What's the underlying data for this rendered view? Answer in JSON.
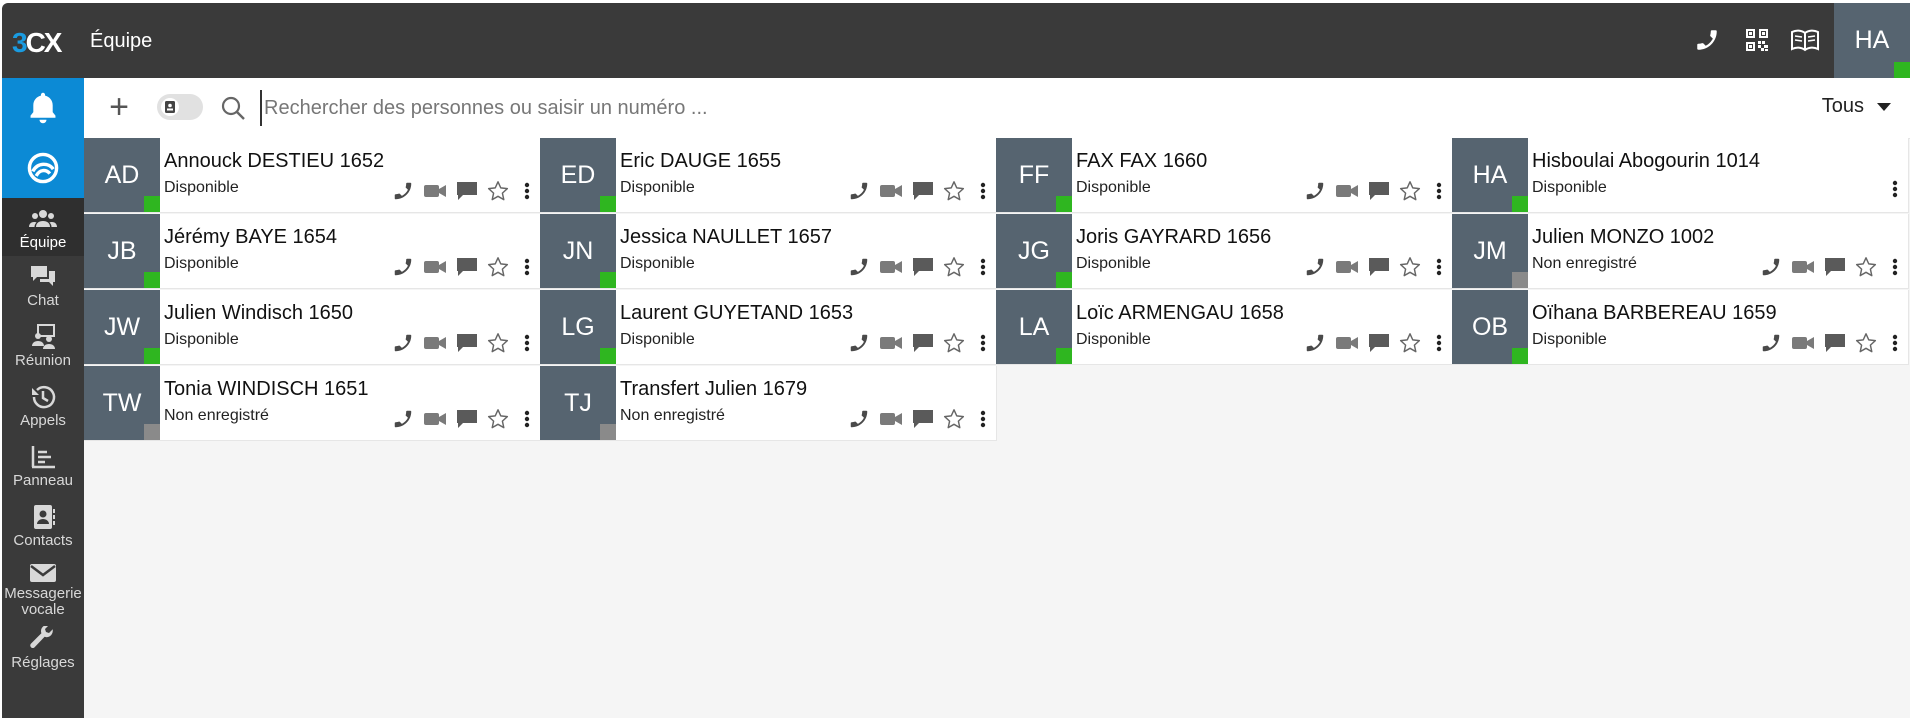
{
  "app": {
    "brand_three": "3",
    "brand_cx": "CX",
    "title": "Équipe"
  },
  "user_initials": "HA",
  "sidebar": [
    {
      "label": "Équipe",
      "icon": "team-icon"
    },
    {
      "label": "Chat",
      "icon": "chat-icon"
    },
    {
      "label": "Réunion",
      "icon": "meeting-icon"
    },
    {
      "label": "Appels",
      "icon": "history-icon"
    },
    {
      "label": "Panneau",
      "icon": "panel-icon"
    },
    {
      "label": "Contacts",
      "icon": "contacts-icon"
    },
    {
      "label": "Messagerie vocale",
      "icon": "voicemail-icon"
    },
    {
      "label": "Réglages",
      "icon": "wrench-icon"
    }
  ],
  "search": {
    "placeholder": "Rechercher des personnes ou saisir un numéro ..."
  },
  "filter": {
    "label": "Tous"
  },
  "colors": {
    "available": "#2fb620",
    "unregistered": "#8a8a8a",
    "accent": "#0c8ad5"
  },
  "contacts": [
    {
      "initials": "AD",
      "name": "Annouck DESTIEU 1652",
      "status": "Disponible",
      "state": "available",
      "actions": true
    },
    {
      "initials": "ED",
      "name": "Eric DAUGE 1655",
      "status": "Disponible",
      "state": "available",
      "actions": true
    },
    {
      "initials": "FF",
      "name": "FAX FAX 1660",
      "status": "Disponible",
      "state": "available",
      "actions": true
    },
    {
      "initials": "HA",
      "name": "Hisboulai Abogourin 1014",
      "status": "Disponible",
      "state": "available",
      "actions": false
    },
    {
      "initials": "JB",
      "name": "Jérémy BAYE 1654",
      "status": "Disponible",
      "state": "available",
      "actions": true
    },
    {
      "initials": "JN",
      "name": "Jessica NAULLET 1657",
      "status": "Disponible",
      "state": "available",
      "actions": true
    },
    {
      "initials": "JG",
      "name": "Joris GAYRARD 1656",
      "status": "Disponible",
      "state": "available",
      "actions": true
    },
    {
      "initials": "JM",
      "name": "Julien MONZO 1002",
      "status": "Non enregistré",
      "state": "unregistered",
      "actions": true
    },
    {
      "initials": "JW",
      "name": "Julien Windisch 1650",
      "status": "Disponible",
      "state": "available",
      "actions": true
    },
    {
      "initials": "LG",
      "name": "Laurent GUYETAND 1653",
      "status": "Disponible",
      "state": "available",
      "actions": true
    },
    {
      "initials": "LA",
      "name": "Loïc ARMENGAU 1658",
      "status": "Disponible",
      "state": "available",
      "actions": true
    },
    {
      "initials": "OB",
      "name": "Oïhana BARBEREAU 1659",
      "status": "Disponible",
      "state": "available",
      "actions": true
    },
    {
      "initials": "TW",
      "name": "Tonia WINDISCH 1651",
      "status": "Non enregistré",
      "state": "unregistered",
      "actions": true
    },
    {
      "initials": "TJ",
      "name": "Transfert Julien 1679",
      "status": "Non enregistré",
      "state": "unregistered",
      "actions": true
    }
  ]
}
